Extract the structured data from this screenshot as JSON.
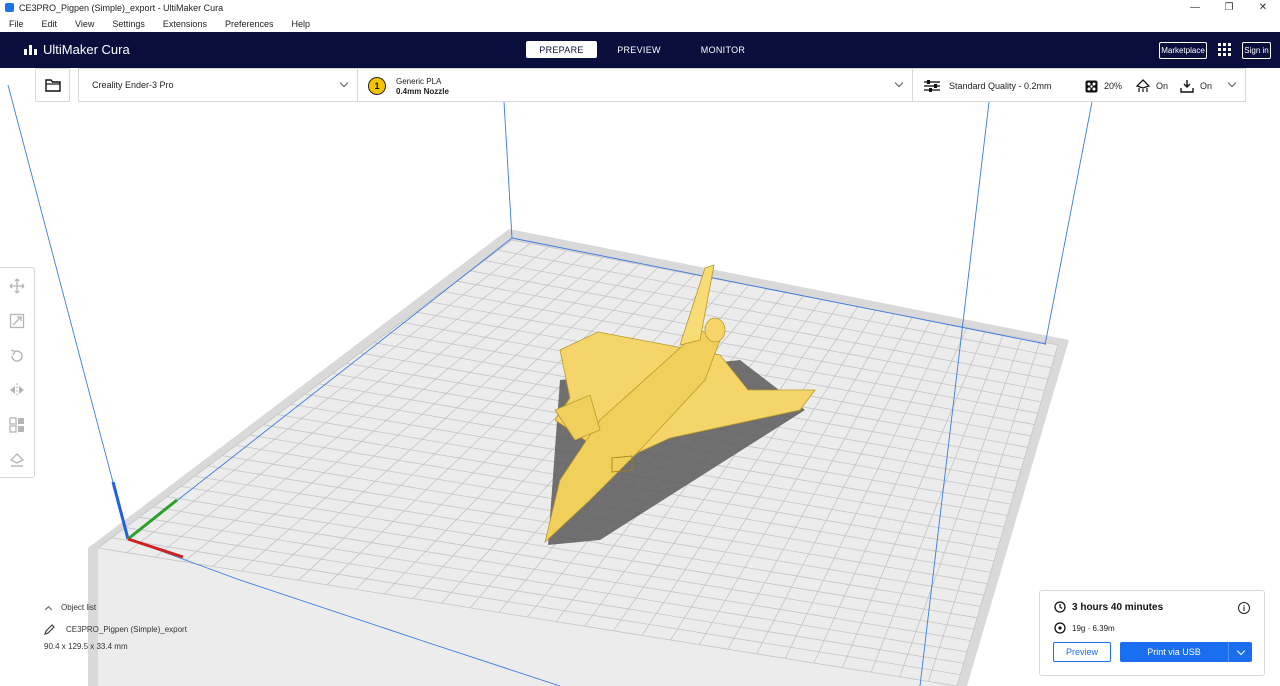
{
  "window": {
    "title": "CE3PRO_Pigpen (Simple)_export - UltiMaker Cura",
    "minimize": "—",
    "maximize": "❐",
    "close": "✕"
  },
  "menu": [
    "File",
    "Edit",
    "View",
    "Settings",
    "Extensions",
    "Preferences",
    "Help"
  ],
  "app": {
    "brand": "UltiMaker Cura",
    "stages": [
      "PREPARE",
      "PREVIEW",
      "MONITOR"
    ],
    "active_stage": "PREPARE",
    "marketplace_label": "Marketplace",
    "signin_label": "Sign in"
  },
  "printer": {
    "name": "Creality Ender-3 Pro"
  },
  "material": {
    "extruder_number": "1",
    "name": "Generic PLA",
    "nozzle": "0.4mm Nozzle",
    "badge_color": "#f5c400"
  },
  "print_settings": {
    "profile": "Standard Quality - 0.2mm",
    "infill": "20%",
    "support": "On",
    "adhesion": "On"
  },
  "toolbar": [
    "move-icon",
    "scale-icon",
    "rotate-icon",
    "mirror-icon",
    "per-model-settings-icon",
    "support-blocker-icon"
  ],
  "object_list": {
    "header": "Object list",
    "object_name": "CE3PRO_Pigpen (Simple)_export",
    "dimensions": "90.4 x 129.5 x 33.4 mm"
  },
  "print_panel": {
    "time": "3 hours 40 minutes",
    "usage": "19g · 6.39m",
    "preview_label": "Preview",
    "print_label": "Print via USB"
  },
  "colors": {
    "appbar": "#0a0e3c",
    "accent": "#196ef0",
    "model": "#f5d56a",
    "build_plate": "#e6e6e6"
  }
}
